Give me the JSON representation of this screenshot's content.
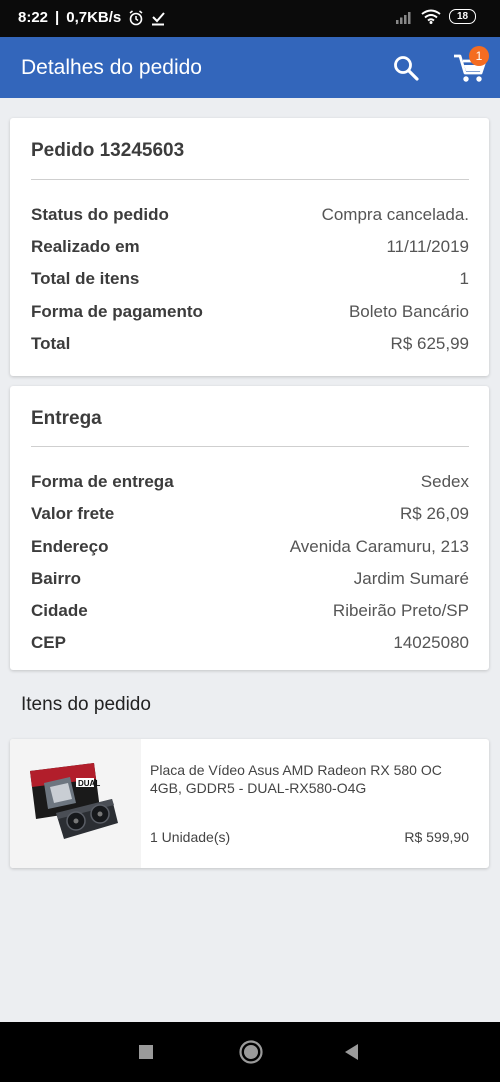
{
  "status_bar": {
    "time": "8:22",
    "network_speed": "0,7KB/s",
    "battery": "18"
  },
  "app_bar": {
    "title": "Detalhes do pedido",
    "cart_count": "1"
  },
  "order": {
    "title": "Pedido 13245603",
    "rows": [
      {
        "label": "Status do pedido",
        "value": "Compra cancelada."
      },
      {
        "label": "Realizado em",
        "value": "11/11/2019"
      },
      {
        "label": "Total de itens",
        "value": "1"
      },
      {
        "label": "Forma de pagamento",
        "value": "Boleto Bancário"
      },
      {
        "label": "Total",
        "value": "R$ 625,99"
      }
    ]
  },
  "delivery": {
    "title": "Entrega",
    "rows": [
      {
        "label": "Forma de entrega",
        "value": "Sedex"
      },
      {
        "label": "Valor frete",
        "value": "R$ 26,09"
      },
      {
        "label": "Endereço",
        "value": "Avenida Caramuru, 213"
      },
      {
        "label": "Bairro",
        "value": "Jardim Sumaré"
      },
      {
        "label": "Cidade",
        "value": "Ribeirão Preto/SP"
      },
      {
        "label": "CEP",
        "value": "14025080"
      }
    ]
  },
  "items_section": {
    "heading": "Itens do pedido",
    "items": [
      {
        "name": "Placa de Vídeo Asus AMD Radeon RX 580 OC 4GB, GDDR5 - DUAL-RX580-O4G",
        "quantity": "1 Unidade(s)",
        "price": "R$ 599,90",
        "box_label": "DUAL"
      }
    ]
  },
  "colors": {
    "app_bar": "#3366bb",
    "badge": "#f46c21",
    "background": "#eceef1"
  },
  "icons": [
    "download-icon",
    "alarm-icon",
    "signal-icon",
    "wifi-icon",
    "battery-icon",
    "search-icon",
    "cart-icon",
    "home-icon",
    "back-icon",
    "recents-icon"
  ]
}
